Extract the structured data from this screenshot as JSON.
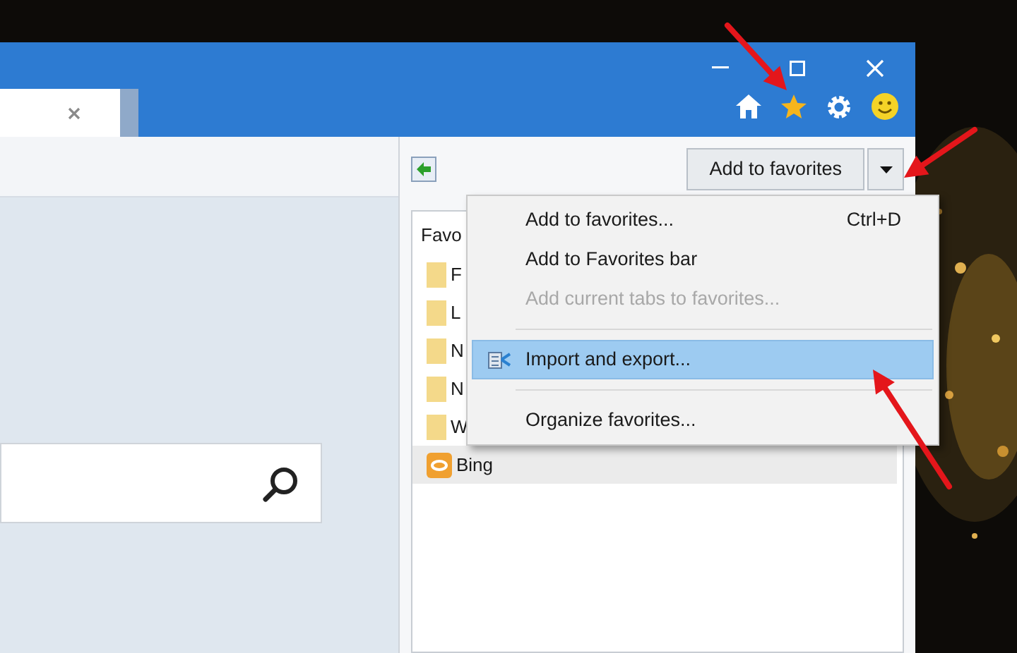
{
  "favorites_center": {
    "add_button": "Add to favorites",
    "header": "Favo",
    "items": [
      {
        "kind": "folder",
        "label": "F",
        "selected": false
      },
      {
        "kind": "folder",
        "label": "L",
        "selected": false
      },
      {
        "kind": "folder",
        "label": "N",
        "selected": false
      },
      {
        "kind": "folder",
        "label": "N",
        "selected": false
      },
      {
        "kind": "folder",
        "label": "W",
        "selected": false
      },
      {
        "kind": "site",
        "label": "Bing",
        "selected": true
      }
    ]
  },
  "menu": {
    "items": [
      {
        "kind": "item",
        "label": "Add to favorites...",
        "shortcut": "Ctrl+D",
        "disabled": false,
        "selected": false
      },
      {
        "kind": "item",
        "label": "Add to Favorites bar",
        "disabled": false,
        "selected": false
      },
      {
        "kind": "item",
        "label": "Add current tabs to favorites...",
        "disabled": true,
        "selected": false
      },
      {
        "kind": "separator"
      },
      {
        "kind": "item",
        "label": "Import and export...",
        "disabled": false,
        "selected": true,
        "icon": true
      },
      {
        "kind": "separator"
      },
      {
        "kind": "item",
        "label": "Organize favorites...",
        "disabled": false,
        "selected": false
      }
    ]
  }
}
